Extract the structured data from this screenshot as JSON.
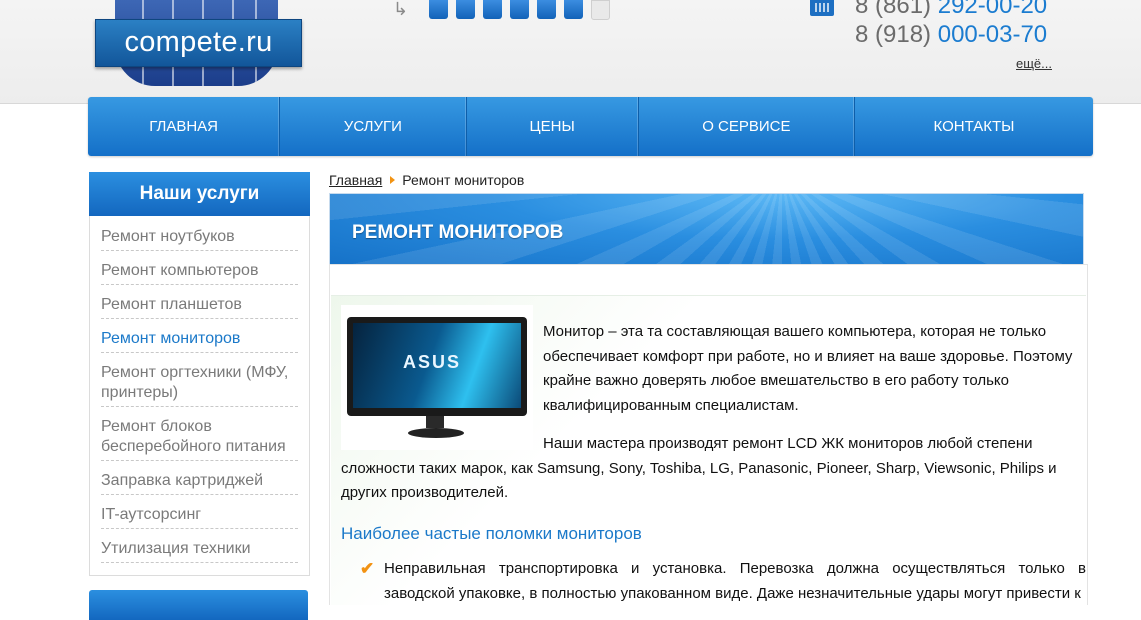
{
  "header": {
    "logo_text": "compete.ru",
    "phones": [
      {
        "prefix": "8 (861)",
        "number": "292-00-20"
      },
      {
        "prefix": "8 (918)",
        "number": "000-03-70"
      }
    ],
    "more_link": "ещё..."
  },
  "nav": {
    "items": [
      {
        "label": "ГЛАВНАЯ"
      },
      {
        "label": "УСЛУГИ"
      },
      {
        "label": "ЦЕНЫ"
      },
      {
        "label": "О СЕРВИСЕ"
      },
      {
        "label": "КОНТАКТЫ"
      }
    ]
  },
  "sidebar": {
    "title": "Наши услуги",
    "items": [
      {
        "label": "Ремонт ноутбуков",
        "active": false
      },
      {
        "label": "Ремонт компьютеров",
        "active": false
      },
      {
        "label": "Ремонт планшетов",
        "active": false
      },
      {
        "label": "Ремонт мониторов",
        "active": true
      },
      {
        "label": "Ремонт оргтехники (МФУ, принтеры)",
        "active": false
      },
      {
        "label": "Ремонт блоков бесперебойного питания",
        "active": false
      },
      {
        "label": "Заправка картриджей",
        "active": false
      },
      {
        "label": "IT-аутсорсинг",
        "active": false
      },
      {
        "label": "Утилизация техники",
        "active": false
      }
    ]
  },
  "breadcrumb": {
    "home": "Главная",
    "current": "Ремонт мониторов"
  },
  "page": {
    "title": "РЕМОНТ МОНИТОРОВ",
    "image_brand": "ASUS",
    "intro": "Монитор – эта та составляющая вашего компьютера, которая не только обеспечивает комфорт при работе, но и влияет на ваше здоровье. Поэтому крайне важно доверять любое вмешательство в его работу только квалифицированным специалистам.",
    "para2": "Наши мастера производят ремонт LCD ЖК мониторов любой степени сложности таких марок, как Samsung, Sony, Toshiba, LG, Panasonic, Pioneer, Sharp, Viewsonic, Philips и других производителей.",
    "section_heading": "Наиболее частые поломки мониторов",
    "list_item_1": "Неправильная транспортировка и установка. Перевозка должна осуществляться только в заводской упаковке, в полностью упакованном виде. Даже незначительные удары могут привести к"
  },
  "colors": {
    "accent": "#1b79c9",
    "nav_top": "#3799e2",
    "nav_bottom": "#1470c8",
    "marker": "#f29313"
  }
}
